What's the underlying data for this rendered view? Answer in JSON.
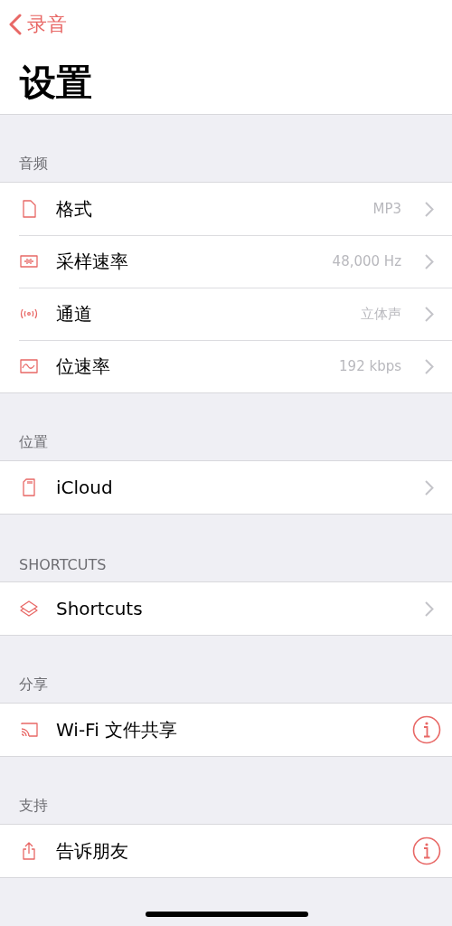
{
  "nav": {
    "back": "录音",
    "title": "设置"
  },
  "sections": [
    {
      "header": "音频",
      "rows": [
        {
          "kind": "file",
          "label": "格式",
          "value": "MP3",
          "info": false
        },
        {
          "kind": "waveform",
          "label": "采样速率",
          "value": "48,000 Hz",
          "info": false
        },
        {
          "kind": "signal",
          "label": "通道",
          "value": "立体声",
          "info": false
        },
        {
          "kind": "wave",
          "label": "位速率",
          "value": "192 kbps",
          "info": false
        }
      ]
    },
    {
      "header": "位置",
      "rows": [
        {
          "kind": "card",
          "label": "iCloud",
          "info": false
        }
      ]
    },
    {
      "header": "SHORTCUTS",
      "rows": [
        {
          "kind": "layers",
          "label": "Shortcuts",
          "info": false
        }
      ]
    },
    {
      "header": "分享",
      "rows": [
        {
          "kind": "cast",
          "label": "Wi-Fi 文件共享",
          "info": true
        }
      ]
    },
    {
      "header": "支持",
      "rows": [
        {
          "kind": "share",
          "label": "告诉朋友",
          "info": true
        }
      ]
    }
  ]
}
